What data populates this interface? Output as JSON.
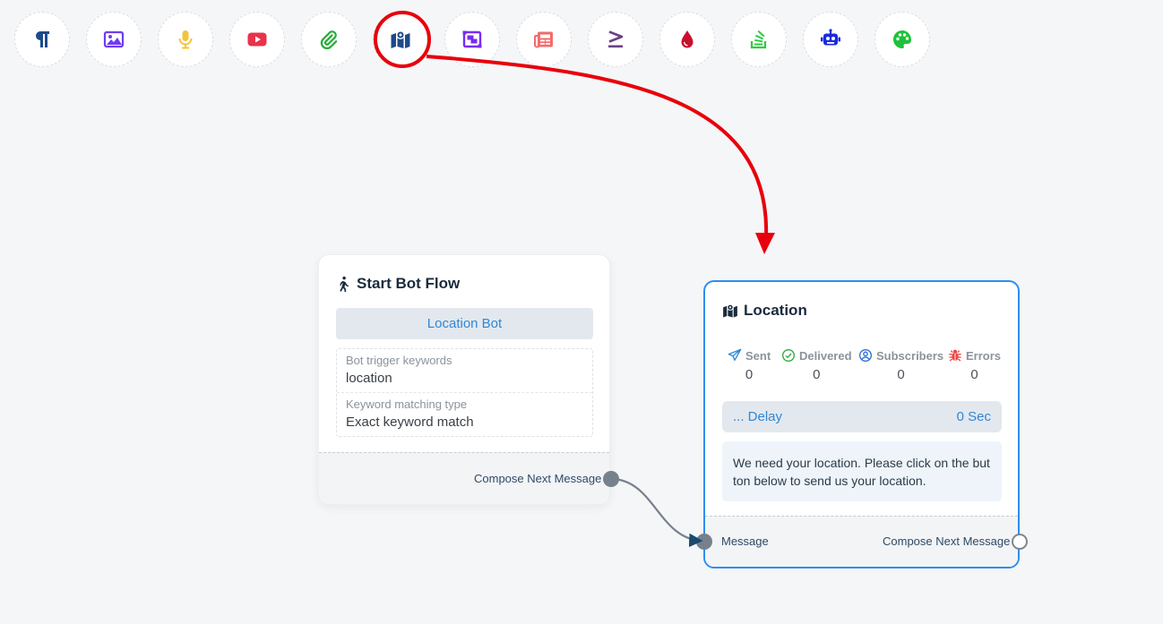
{
  "toolbar": {
    "tools": [
      {
        "name": "text",
        "icon": "paragraph-icon",
        "color": "#1c4a8a"
      },
      {
        "name": "image",
        "icon": "image-icon",
        "color": "#6f3cf0"
      },
      {
        "name": "audio",
        "icon": "microphone-icon",
        "color": "#f5c33b"
      },
      {
        "name": "video",
        "icon": "youtube-icon",
        "color": "#e8334a"
      },
      {
        "name": "file",
        "icon": "paperclip-icon",
        "color": "#2eaa3f"
      },
      {
        "name": "location",
        "icon": "map-location-icon",
        "color": "#1c4a8a",
        "highlighted": true
      },
      {
        "name": "carousel",
        "icon": "carousel-icon",
        "color": "#7a2bf0"
      },
      {
        "name": "list",
        "icon": "newspaper-icon",
        "color": "#f46b6b"
      },
      {
        "name": "condition",
        "icon": "greater-equal-icon",
        "color": "#6b3f86"
      },
      {
        "name": "otn",
        "icon": "droplet-icon",
        "color": "#c8102e"
      },
      {
        "name": "stack",
        "icon": "stack-overflow-icon",
        "color": "#2ecc40"
      },
      {
        "name": "ai",
        "icon": "robot-icon",
        "color": "#1a2be0"
      },
      {
        "name": "theme",
        "icon": "palette-icon",
        "color": "#1ec23a"
      }
    ]
  },
  "annotation": {
    "color": "#e8000b"
  },
  "start_node": {
    "title": "Start Bot Flow",
    "bot_name": "Location Bot",
    "trigger_label": "Bot trigger keywords",
    "trigger_value": "location",
    "match_label": "Keyword matching type",
    "match_value": "Exact keyword match",
    "footer_label": "Compose Next Message"
  },
  "location_node": {
    "title": "Location",
    "stats": {
      "sent_label": "Sent",
      "sent_value": "0",
      "delivered_label": "Delivered",
      "delivered_value": "0",
      "subscribers_label": "Subscribers",
      "subscribers_value": "0",
      "errors_label": "Errors",
      "errors_value": "0"
    },
    "delay_label": "... Delay",
    "delay_value": "0 Sec",
    "message": "We need your location. Please click on the button below to send us your location.",
    "input_label": "Message",
    "output_label": "Compose Next Message"
  }
}
